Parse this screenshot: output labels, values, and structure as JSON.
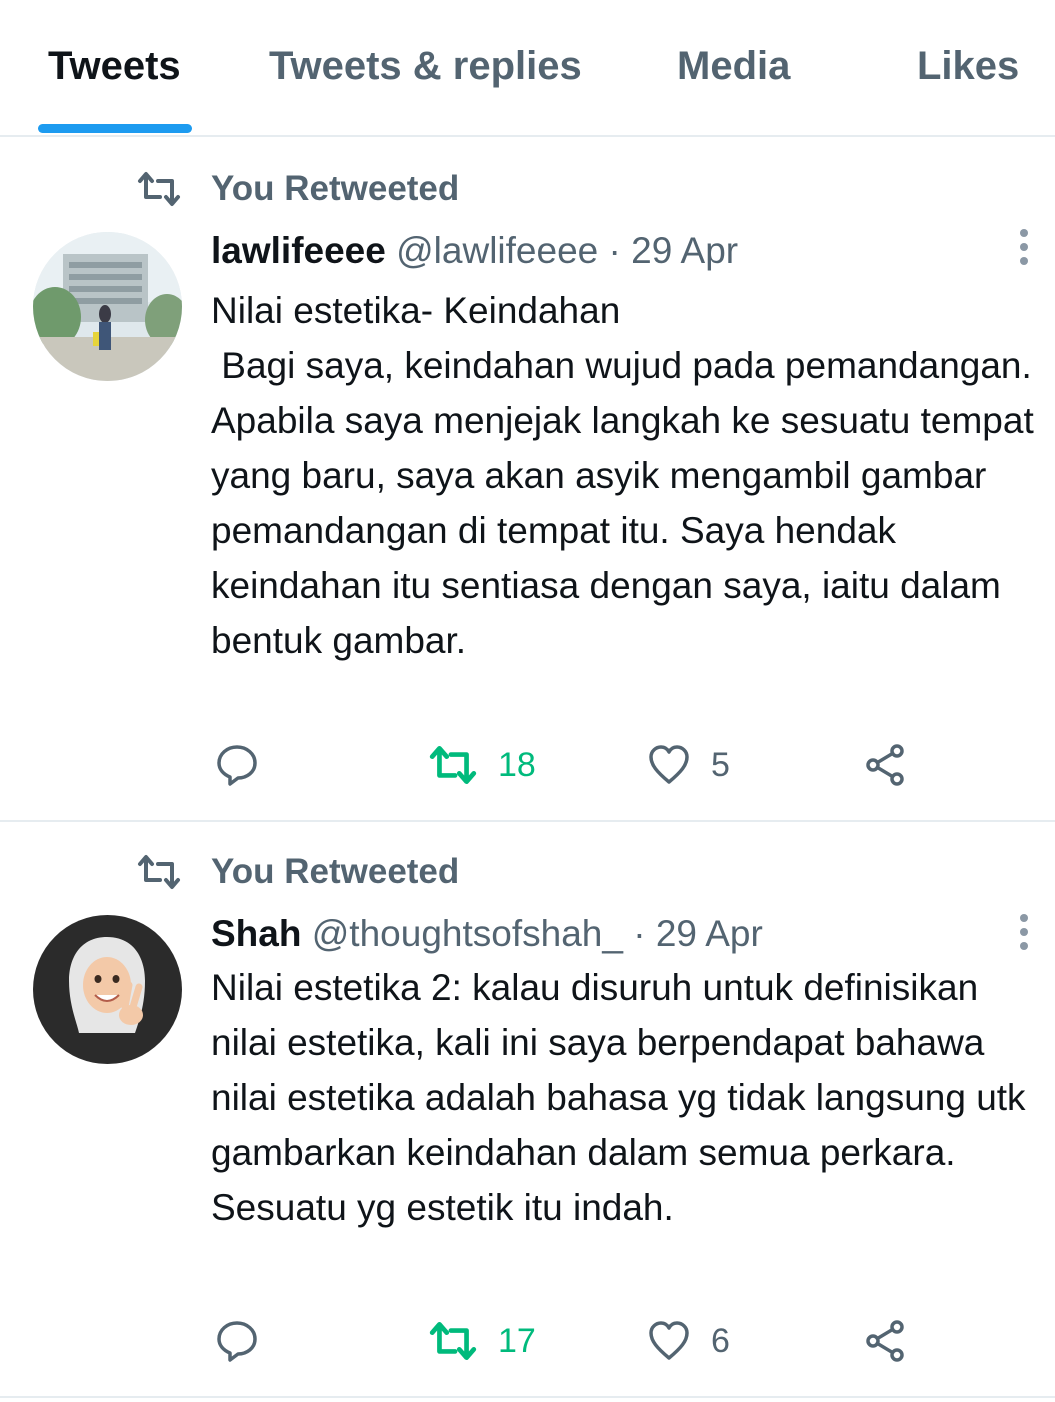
{
  "tabs": [
    {
      "label": "Tweets",
      "active": true
    },
    {
      "label": "Tweets & replies",
      "active": false
    },
    {
      "label": "Media",
      "active": false
    },
    {
      "label": "Likes",
      "active": false
    }
  ],
  "colors": {
    "accent": "#1d9bf0",
    "retweet_green": "#00ba7c",
    "secondary_text": "#536471"
  },
  "tweets": [
    {
      "retweet_label": "You Retweeted",
      "name": "lawlifeeee",
      "handle": "@lawlifeeee",
      "separator": "·",
      "date": "29 Apr",
      "text": "Nilai estetika- Keindahan\n Bagi saya, keindahan wujud pada pemandangan. Apabila saya menjejak langkah ke sesuatu tempat yang baru, saya akan asyik mengambil gambar pemandangan di tempat itu. Saya hendak keindahan itu sentiasa dengan saya, iaitu dalam bentuk gambar.",
      "retweets": "18",
      "likes": "5",
      "retweeted_by_me": true
    },
    {
      "retweet_label": "You Retweeted",
      "name": "Shah",
      "handle": "@thoughtsofshah_",
      "separator": "·",
      "date": "29 Apr",
      "text": "Nilai estetika 2: kalau disuruh untuk definisikan nilai estetika, kali ini saya berpendapat bahawa nilai estetika adalah bahasa yg tidak langsung utk gambarkan keindahan dalam semua perkara. Sesuatu yg estetik itu indah.",
      "retweets": "17",
      "likes": "6",
      "retweeted_by_me": true
    }
  ],
  "icons": {
    "retweet": "retweet-icon",
    "reply": "reply-icon",
    "like": "heart-icon",
    "share": "share-icon",
    "more": "more-options-icon"
  }
}
